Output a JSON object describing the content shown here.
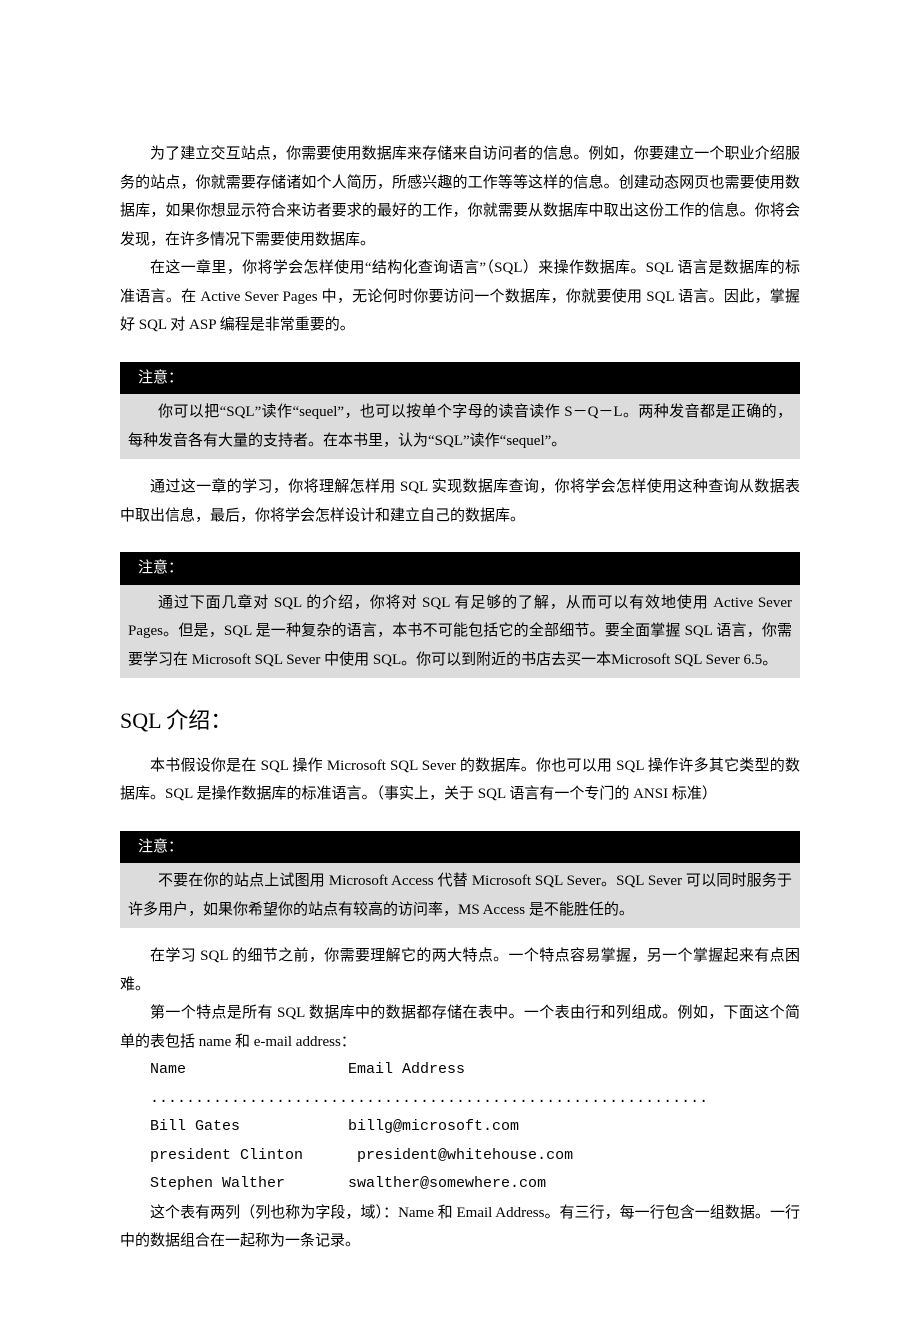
{
  "paragraphs": {
    "p1": "为了建立交互站点，你需要使用数据库来存储来自访问者的信息。例如，你要建立一个职业介绍服务的站点，你就需要存储诸如个人简历，所感兴趣的工作等等这样的信息。创建动态网页也需要使用数据库，如果你想显示符合来访者要求的最好的工作，你就需要从数据库中取出这份工作的信息。你将会发现，在许多情况下需要使用数据库。",
    "p2": "在这一章里，你将学会怎样使用“结构化查询语言”（SQL）来操作数据库。SQL 语言是数据库的标准语言。在 Active Sever Pages 中，无论何时你要访问一个数据库，你就要使用 SQL 语言。因此，掌握好 SQL 对 ASP 编程是非常重要的。",
    "p3": "通过这一章的学习，你将理解怎样用 SQL 实现数据库查询，你将学会怎样使用这种查询从数据表中取出信息，最后，你将学会怎样设计和建立自己的数据库。",
    "p4": "本书假设你是在 SQL 操作 Microsoft SQL Sever 的数据库。你也可以用 SQL 操作许多其它类型的数据库。SQL 是操作数据库的标准语言。（事实上，关于 SQL 语言有一个专门的 ANSI 标准）",
    "p5": "在学习 SQL 的细节之前，你需要理解它的两大特点。一个特点容易掌握，另一个掌握起来有点困难。",
    "p6": "第一个特点是所有 SQL 数据库中的数据都存储在表中。一个表由行和列组成。例如，下面这个简单的表包括 name 和 e-mail address：",
    "p7": "这个表有两列（列也称为字段，域）：Name 和 Email Address。有三行，每一行包含一组数据。一行中的数据组合在一起称为一条记录。"
  },
  "notes": {
    "label": "注意：",
    "n1": "你可以把“SQL”读作“sequel”，也可以按单个字母的读音读作 S－Q－L。两种发音都是正确的，每种发音各有大量的支持者。在本书里，认为“SQL”读作“sequel”。",
    "n2": "通过下面几章对 SQL 的介绍，你将对 SQL 有足够的了解，从而可以有效地使用 Active Sever Pages。但是，SQL 是一种复杂的语言，本书不可能包括它的全部细节。要全面掌握 SQL 语言，你需要学习在 Microsoft SQL Sever 中使用 SQL。你可以到附近的书店去买一本Microsoft SQL Sever 6.5。",
    "n3": "不要在你的站点上试图用 Microsoft Access 代替 Microsoft SQL Sever。SQL Sever 可以同时服务于许多用户，如果你希望你的站点有较高的访问率，MS Access 是不能胜任的。"
  },
  "section": {
    "title": "SQL 介绍："
  },
  "table": {
    "header": "Name                  Email Address",
    "separator": "..............................................................",
    "row1": "Bill Gates            billg@microsoft.com",
    "row2": "president Clinton      president@whitehouse.com",
    "row3": "Stephen Walther       swalther@somewhere.com"
  }
}
